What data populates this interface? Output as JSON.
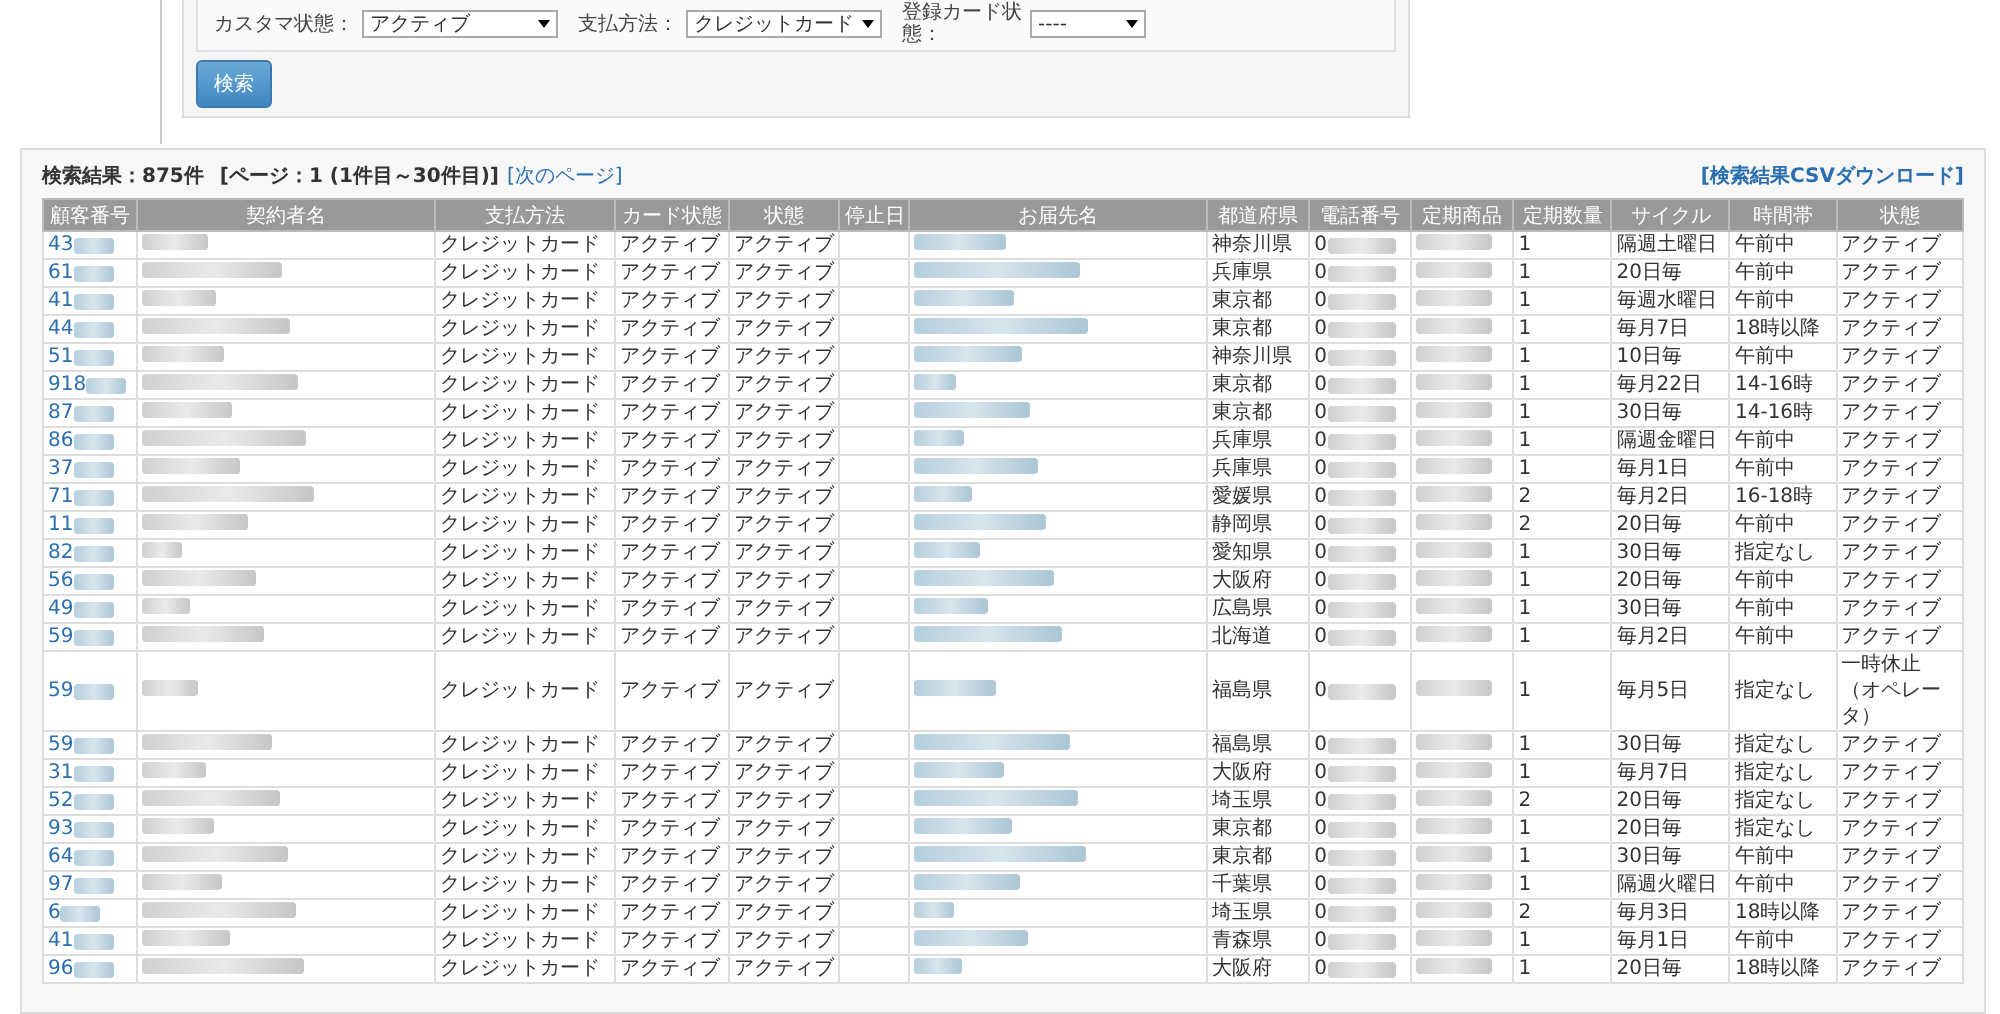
{
  "search_form": {
    "fields": [
      {
        "label": "カスタマ状態：",
        "value": "アクティブ"
      },
      {
        "label": "支払方法：",
        "value": "クレジットカード"
      },
      {
        "label": "登録カード状態：",
        "value": "----"
      }
    ],
    "button": "検索"
  },
  "results": {
    "summary": "検索結果：875件",
    "page_info": "[ページ：1 (1件目～30件目)]",
    "next_link": "[次のページ]",
    "csv_link": "[検索結果CSVダウンロード]",
    "table": {
      "columns": [
        "顧客番号",
        "契約者名",
        "支払方法",
        "カード状態",
        "状態",
        "停止日",
        "お届先名",
        "都道府県",
        "電話番号",
        "定期商品",
        "定期数量",
        "サイクル",
        "時間帯",
        "状態"
      ],
      "rows": [
        {
          "customer_no": "43",
          "payment": "クレジットカード",
          "card_status": "アクティブ",
          "status": "アクティブ",
          "prefecture": "神奈川県",
          "phone": "0",
          "quantity": "1",
          "cycle": "隔週土曜日",
          "time_slot": "午前中",
          "subscription_status": "アクティブ"
        },
        {
          "customer_no": "61",
          "payment": "クレジットカード",
          "card_status": "アクティブ",
          "status": "アクティブ",
          "prefecture": "兵庫県",
          "phone": "0",
          "quantity": "1",
          "cycle": "20日毎",
          "time_slot": "午前中",
          "subscription_status": "アクティブ"
        },
        {
          "customer_no": "41",
          "payment": "クレジットカード",
          "card_status": "アクティブ",
          "status": "アクティブ",
          "prefecture": "東京都",
          "phone": "0",
          "quantity": "1",
          "cycle": "毎週水曜日",
          "time_slot": "午前中",
          "subscription_status": "アクティブ"
        },
        {
          "customer_no": "44",
          "payment": "クレジットカード",
          "card_status": "アクティブ",
          "status": "アクティブ",
          "prefecture": "東京都",
          "phone": "0",
          "quantity": "1",
          "cycle": "毎月7日",
          "time_slot": "18時以降",
          "subscription_status": "アクティブ"
        },
        {
          "customer_no": "51",
          "payment": "クレジットカード",
          "card_status": "アクティブ",
          "status": "アクティブ",
          "prefecture": "神奈川県",
          "phone": "0",
          "quantity": "1",
          "cycle": "10日毎",
          "time_slot": "午前中",
          "subscription_status": "アクティブ"
        },
        {
          "customer_no": "918",
          "payment": "クレジットカード",
          "card_status": "アクティブ",
          "status": "アクティブ",
          "prefecture": "東京都",
          "phone": "0",
          "quantity": "1",
          "cycle": "毎月22日",
          "time_slot": "14-16時",
          "subscription_status": "アクティブ"
        },
        {
          "customer_no": "87",
          "payment": "クレジットカード",
          "card_status": "アクティブ",
          "status": "アクティブ",
          "prefecture": "東京都",
          "phone": "0",
          "quantity": "1",
          "cycle": "30日毎",
          "time_slot": "14-16時",
          "subscription_status": "アクティブ"
        },
        {
          "customer_no": "86",
          "payment": "クレジットカード",
          "card_status": "アクティブ",
          "status": "アクティブ",
          "prefecture": "兵庫県",
          "phone": "0",
          "quantity": "1",
          "cycle": "隔週金曜日",
          "time_slot": "午前中",
          "subscription_status": "アクティブ"
        },
        {
          "customer_no": "37",
          "payment": "クレジットカード",
          "card_status": "アクティブ",
          "status": "アクティブ",
          "prefecture": "兵庫県",
          "phone": "0",
          "quantity": "1",
          "cycle": "毎月1日",
          "time_slot": "午前中",
          "subscription_status": "アクティブ"
        },
        {
          "customer_no": "71",
          "payment": "クレジットカード",
          "card_status": "アクティブ",
          "status": "アクティブ",
          "prefecture": "愛媛県",
          "phone": "0",
          "quantity": "2",
          "cycle": "毎月2日",
          "time_slot": "16-18時",
          "subscription_status": "アクティブ"
        },
        {
          "customer_no": "11",
          "payment": "クレジットカード",
          "card_status": "アクティブ",
          "status": "アクティブ",
          "prefecture": "静岡県",
          "phone": "0",
          "quantity": "2",
          "cycle": "20日毎",
          "time_slot": "午前中",
          "subscription_status": "アクティブ"
        },
        {
          "customer_no": "82",
          "payment": "クレジットカード",
          "card_status": "アクティブ",
          "status": "アクティブ",
          "prefecture": "愛知県",
          "phone": "0",
          "quantity": "1",
          "cycle": "30日毎",
          "time_slot": "指定なし",
          "subscription_status": "アクティブ"
        },
        {
          "customer_no": "56",
          "payment": "クレジットカード",
          "card_status": "アクティブ",
          "status": "アクティブ",
          "prefecture": "大阪府",
          "phone": "0",
          "quantity": "1",
          "cycle": "20日毎",
          "time_slot": "午前中",
          "subscription_status": "アクティブ"
        },
        {
          "customer_no": "49",
          "payment": "クレジットカード",
          "card_status": "アクティブ",
          "status": "アクティブ",
          "prefecture": "広島県",
          "phone": "0",
          "quantity": "1",
          "cycle": "30日毎",
          "time_slot": "午前中",
          "subscription_status": "アクティブ"
        },
        {
          "customer_no": "59",
          "payment": "クレジットカード",
          "card_status": "アクティブ",
          "status": "アクティブ",
          "prefecture": "北海道",
          "phone": "0",
          "quantity": "1",
          "cycle": "毎月2日",
          "time_slot": "午前中",
          "subscription_status": "アクティブ"
        },
        {
          "customer_no": "59",
          "payment": "クレジットカード",
          "card_status": "アクティブ",
          "status": "アクティブ",
          "prefecture": "福島県",
          "phone": "0",
          "quantity": "1",
          "cycle": "毎月5日",
          "time_slot": "指定なし",
          "subscription_status": "一時休止（オペレータ）"
        },
        {
          "customer_no": "59",
          "payment": "クレジットカード",
          "card_status": "アクティブ",
          "status": "アクティブ",
          "prefecture": "福島県",
          "phone": "0",
          "quantity": "1",
          "cycle": "30日毎",
          "time_slot": "指定なし",
          "subscription_status": "アクティブ"
        },
        {
          "customer_no": "31",
          "payment": "クレジットカード",
          "card_status": "アクティブ",
          "status": "アクティブ",
          "prefecture": "大阪府",
          "phone": "0",
          "quantity": "1",
          "cycle": "毎月7日",
          "time_slot": "指定なし",
          "subscription_status": "アクティブ"
        },
        {
          "customer_no": "52",
          "payment": "クレジットカード",
          "card_status": "アクティブ",
          "status": "アクティブ",
          "prefecture": "埼玉県",
          "phone": "0",
          "quantity": "2",
          "cycle": "20日毎",
          "time_slot": "指定なし",
          "subscription_status": "アクティブ"
        },
        {
          "customer_no": "93",
          "payment": "クレジットカード",
          "card_status": "アクティブ",
          "status": "アクティブ",
          "prefecture": "東京都",
          "phone": "0",
          "quantity": "1",
          "cycle": "20日毎",
          "time_slot": "指定なし",
          "subscription_status": "アクティブ"
        },
        {
          "customer_no": "64",
          "payment": "クレジットカード",
          "card_status": "アクティブ",
          "status": "アクティブ",
          "prefecture": "東京都",
          "phone": "0",
          "quantity": "1",
          "cycle": "30日毎",
          "time_slot": "午前中",
          "subscription_status": "アクティブ"
        },
        {
          "customer_no": "97",
          "payment": "クレジットカード",
          "card_status": "アクティブ",
          "status": "アクティブ",
          "prefecture": "千葉県",
          "phone": "0",
          "quantity": "1",
          "cycle": "隔週火曜日",
          "time_slot": "午前中",
          "subscription_status": "アクティブ"
        },
        {
          "customer_no": "6",
          "payment": "クレジットカード",
          "card_status": "アクティブ",
          "status": "アクティブ",
          "prefecture": "埼玉県",
          "phone": "0",
          "quantity": "2",
          "cycle": "毎月3日",
          "time_slot": "18時以降",
          "subscription_status": "アクティブ"
        },
        {
          "customer_no": "41",
          "payment": "クレジットカード",
          "card_status": "アクティブ",
          "status": "アクティブ",
          "prefecture": "青森県",
          "phone": "0",
          "quantity": "1",
          "cycle": "毎月1日",
          "time_slot": "午前中",
          "subscription_status": "アクティブ"
        },
        {
          "customer_no": "96",
          "payment": "クレジットカード",
          "card_status": "アクティブ",
          "status": "アクティブ",
          "prefecture": "大阪府",
          "phone": "0",
          "quantity": "1",
          "cycle": "20日毎",
          "time_slot": "18時以降",
          "subscription_status": "アクティブ"
        }
      ]
    }
  }
}
